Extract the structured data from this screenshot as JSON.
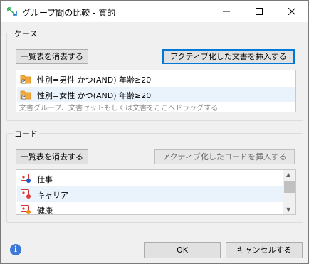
{
  "window": {
    "title": "グループ間の比較 - 質的"
  },
  "docs_group": {
    "legend": "ケース",
    "clear_btn": "一覧表を消去する",
    "insert_btn": "アクティブ化した文書を挿入する",
    "items": [
      {
        "label": "性別=男性 かつ(AND) 年齢≥20"
      },
      {
        "label": "性別=女性 かつ(AND) 年齢≥20"
      }
    ],
    "hint": "文書グループ、文書セットもしくは文書をここへドラッグする"
  },
  "codes_group": {
    "legend": "コード",
    "clear_btn": "一覧表を消去する",
    "insert_btn": "アクティブ化したコードを挿入する",
    "items": [
      {
        "label": "仕事",
        "color": "#1f56c9"
      },
      {
        "label": "キャリア",
        "color": "#e03a3a"
      },
      {
        "label": "健康",
        "color": "#f08a1c"
      }
    ]
  },
  "footer": {
    "ok": "OK",
    "cancel": "キャンセルする"
  }
}
